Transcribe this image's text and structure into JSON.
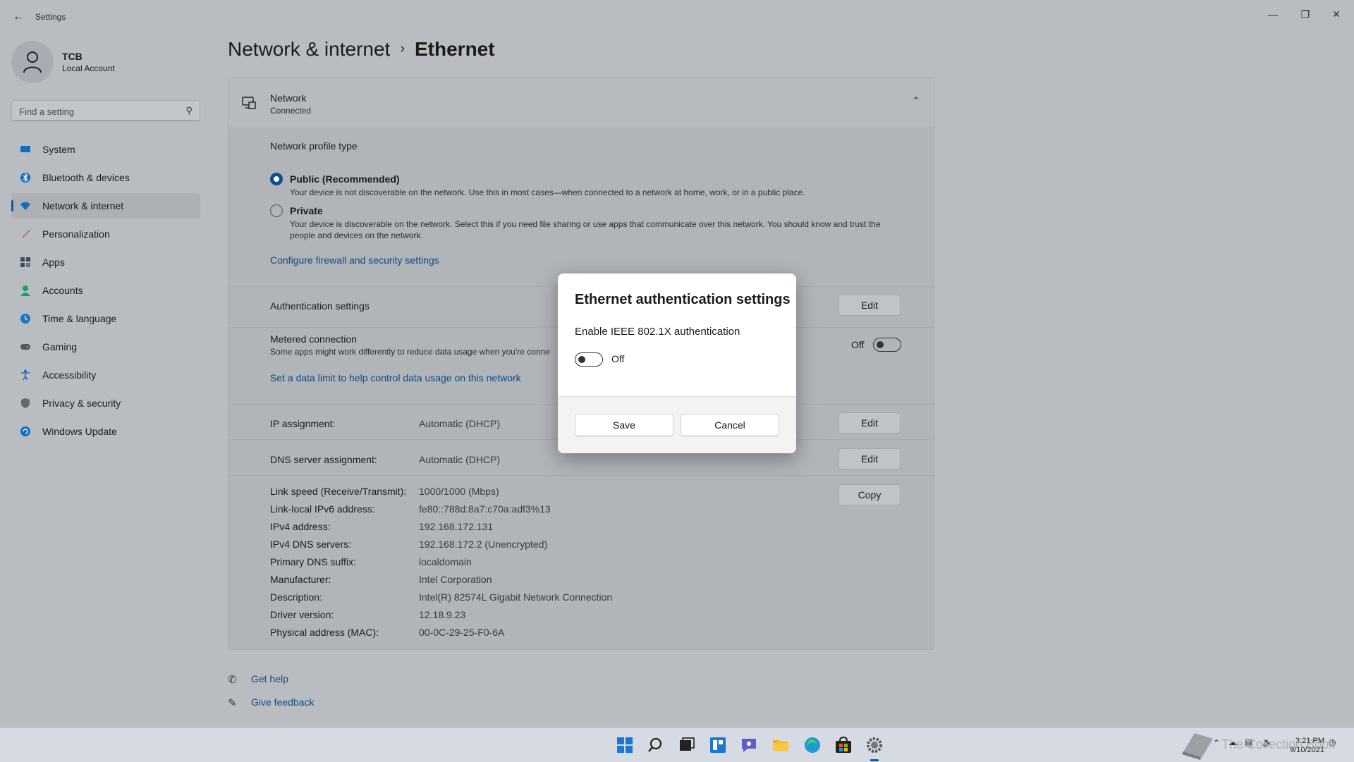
{
  "window": {
    "title": "Settings",
    "back_icon": "arrow-left-icon",
    "controls": [
      "minimize-icon",
      "maximize-icon",
      "close-icon"
    ]
  },
  "profile": {
    "name": "TCB",
    "account_type": "Local Account"
  },
  "search": {
    "placeholder": "Find a setting"
  },
  "sidebar": {
    "items": [
      {
        "label": "System",
        "icon": "monitor-icon",
        "color": "#0b6fc2",
        "active": false
      },
      {
        "label": "Bluetooth & devices",
        "icon": "bluetooth-icon",
        "color": "#0b6fc2",
        "active": false
      },
      {
        "label": "Network & internet",
        "icon": "wifi-icon",
        "color": "#0b6fc2",
        "active": true
      },
      {
        "label": "Personalization",
        "icon": "brush-icon",
        "color": "#c0641a",
        "active": false
      },
      {
        "label": "Apps",
        "icon": "apps-icon",
        "color": "#3a4b60",
        "active": false
      },
      {
        "label": "Accounts",
        "icon": "person-icon",
        "color": "#1aa05a",
        "active": false
      },
      {
        "label": "Time & language",
        "icon": "globe-clock-icon",
        "color": "#1a78c2",
        "active": false
      },
      {
        "label": "Gaming",
        "icon": "controller-icon",
        "color": "#555555",
        "active": false
      },
      {
        "label": "Accessibility",
        "icon": "accessibility-icon",
        "color": "#1a6fc2",
        "active": false
      },
      {
        "label": "Privacy & security",
        "icon": "shield-icon",
        "color": "#666666",
        "active": false
      },
      {
        "label": "Windows Update",
        "icon": "update-icon",
        "color": "#0b6fc2",
        "active": false
      }
    ]
  },
  "breadcrumb": {
    "parent": "Network & internet",
    "separator": "›",
    "current": "Ethernet"
  },
  "network": {
    "name": "Network",
    "status": "Connected"
  },
  "profile_type": {
    "heading": "Network profile type",
    "public": {
      "label": "Public (Recommended)",
      "desc": "Your device is not discoverable on the network. Use this in most cases—when connected to a network at home, work, or in a public place.",
      "selected": true
    },
    "private": {
      "label": "Private",
      "desc_line1": "Your device is discoverable on the network. Select this if you need file sharing or use apps that communicate over this network. You should know and trust the",
      "desc_line2": "people and devices on the network.",
      "selected": false
    },
    "firewall_link": "Configure firewall and security settings"
  },
  "auth": {
    "label": "Authentication settings",
    "button": "Edit"
  },
  "metered": {
    "label": "Metered connection",
    "desc": "Some apps might work differently to reduce data usage when you're conne",
    "state": "Off",
    "link": "Set a data limit to help control data usage on this network"
  },
  "ip": {
    "label": "IP assignment:",
    "value": "Automatic (DHCP)",
    "button": "Edit"
  },
  "dns": {
    "label": "DNS server assignment:",
    "value": "Automatic (DHCP)",
    "button": "Edit"
  },
  "copy_button": "Copy",
  "properties": [
    {
      "key": "Link speed (Receive/Transmit):",
      "value": "1000/1000 (Mbps)"
    },
    {
      "key": "Link-local IPv6 address:",
      "value": "fe80::788d:8a7:c70a:adf3%13"
    },
    {
      "key": "IPv4 address:",
      "value": "192.168.172.131"
    },
    {
      "key": "IPv4 DNS servers:",
      "value": "192.168.172.2 (Unencrypted)"
    },
    {
      "key": "Primary DNS suffix:",
      "value": "localdomain"
    },
    {
      "key": "Manufacturer:",
      "value": "Intel Corporation"
    },
    {
      "key": "Description:",
      "value": "Intel(R) 82574L Gigabit Network Connection"
    },
    {
      "key": "Driver version:",
      "value": "12.18.9.23"
    },
    {
      "key": "Physical address (MAC):",
      "value": "00-0C-29-25-F0-6A"
    }
  ],
  "help": {
    "get_help": "Get help",
    "give_feedback": "Give feedback"
  },
  "dialog": {
    "title": "Ethernet authentication settings",
    "toggle_label": "Enable IEEE 802.1X authentication",
    "toggle_state": "Off",
    "save": "Save",
    "cancel": "Cancel"
  },
  "taskbar": {
    "apps": [
      "start-icon",
      "search-icon",
      "task-view-icon",
      "widgets-icon",
      "chat-icon",
      "file-explorer-icon",
      "edge-icon",
      "store-icon",
      "settings-icon"
    ],
    "active": "settings-icon",
    "time": "3:21 PM",
    "date": "9/10/2021"
  },
  "watermark": {
    "text": "TenForums Tutorials-style book logo",
    "visible_text": "The Collection Book"
  },
  "colors": {
    "accent": "#0b5ba0",
    "link": "#0b4a85",
    "dialog_bg": "#ffffff",
    "overlay_bg": "#b9bcc1"
  }
}
